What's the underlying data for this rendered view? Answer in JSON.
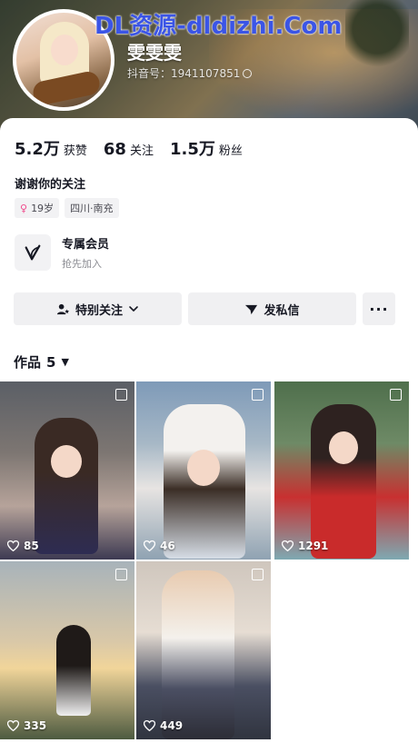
{
  "watermark": "DL资源-dldizhi.Com",
  "profile": {
    "nickname": "雯雯雯",
    "douyin_id": "抖音号：1941107851"
  },
  "stats": [
    {
      "num": "5.2万",
      "label": "获赞"
    },
    {
      "num": "68",
      "label": "关注"
    },
    {
      "num": "1.5万",
      "label": "粉丝"
    }
  ],
  "signature": "谢谢你的关注",
  "tags": {
    "gender_symbol": "♀",
    "age": "19岁",
    "location": "四川·南充"
  },
  "member": {
    "title": "专属会员",
    "subtitle": "抢先加入"
  },
  "actions": {
    "follow_label": "特别关注",
    "message_label": "发私信",
    "more_label": "···"
  },
  "works": {
    "label": "作品",
    "count": "5",
    "caret": "▼"
  },
  "videos": [
    {
      "likes": "85"
    },
    {
      "likes": "46"
    },
    {
      "likes": "1291"
    },
    {
      "likes": "335"
    },
    {
      "likes": "449"
    }
  ],
  "colors": {
    "accent_pink": "#f0478a",
    "watermark_blue": "#3b55e6",
    "button_bg": "#f0f0f2"
  }
}
